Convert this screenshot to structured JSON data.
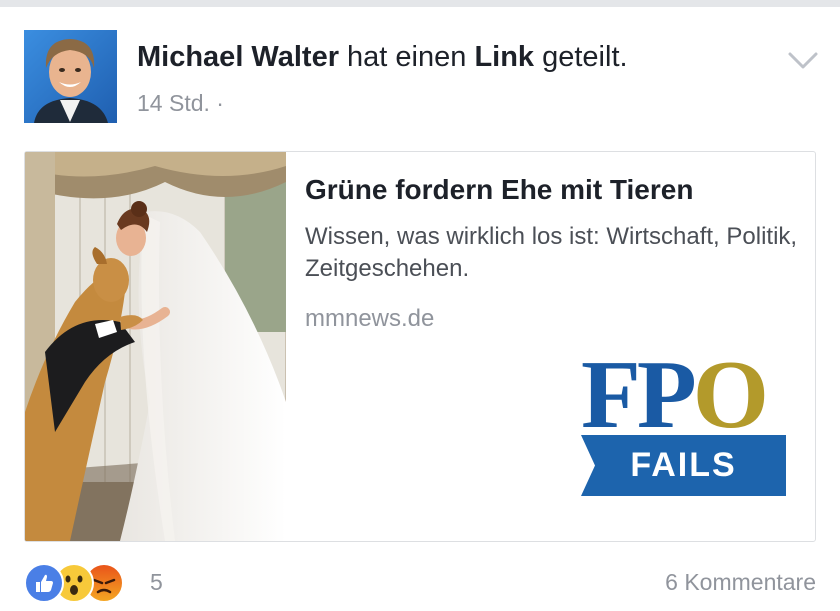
{
  "post": {
    "author_name": "Michael Walter",
    "action_prefix": " hat einen ",
    "action_link": "Link",
    "action_suffix": " geteilt.",
    "timestamp": "14 Std.",
    "separator": "·",
    "menu_icon": "chevron-down-icon"
  },
  "link_card": {
    "title": "Grüne fordern Ehe mit Tieren",
    "description": "Wissen, was wirklich los ist: Wirtschaft, Politik, Zeitgeschehen.",
    "domain": "mmnews.de",
    "image": "bride-kissing-dog-in-tuxedo"
  },
  "watermark": {
    "word_fp": "FP",
    "word_o": "O",
    "band_text": "FAILS",
    "colors": {
      "blue": "#1a5aa4",
      "gold": "#b39a2b",
      "band": "#1d64ad"
    }
  },
  "footer": {
    "reaction_icons": [
      "like-icon",
      "wow-icon",
      "angry-icon"
    ],
    "reaction_count": "5",
    "comments": "6 Kommentare"
  },
  "colors": {
    "text_primary": "#1d2129",
    "text_secondary": "#90949c",
    "link_blue": "#4080ff"
  }
}
